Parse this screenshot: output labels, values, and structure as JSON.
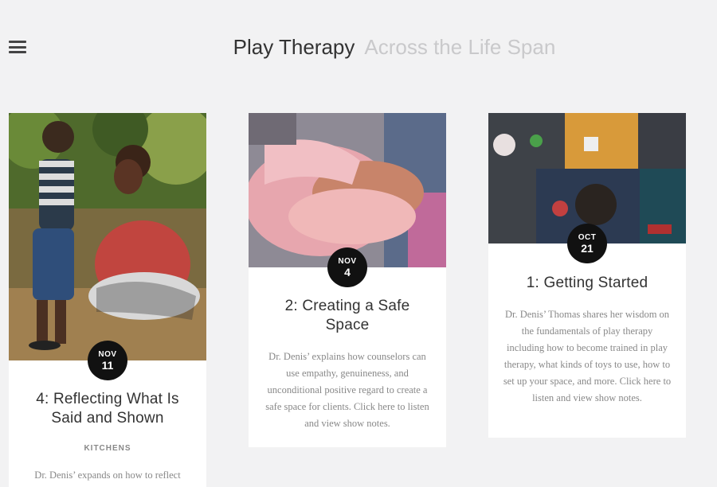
{
  "header": {
    "menu_icon": "hamburger-menu-icon",
    "title_main": "Play Therapy",
    "title_sub": "Across the Life Span"
  },
  "posts": [
    {
      "month": "NOV",
      "day": "11",
      "title": "4: Reflecting What Is Said and Shown",
      "category": "KITCHENS",
      "excerpt": "Dr. Denis’ expands on how to reflect"
    },
    {
      "month": "NOV",
      "day": "4",
      "title": "2: Creating a Safe Space",
      "excerpt": "Dr. Denis’ explains how counselors can use empathy, genuineness, and unconditional positive regard to create a safe space for clients. Click here to listen and view show notes."
    },
    {
      "month": "OCT",
      "day": "21",
      "title": "1: Getting Started",
      "excerpt": "Dr. Denis’ Thomas shares her wisdom on the fundamentals of play therapy including how to become trained in play therapy, what kinds of toys to use, how to set up your space, and more. Click here to listen and view show notes."
    }
  ]
}
